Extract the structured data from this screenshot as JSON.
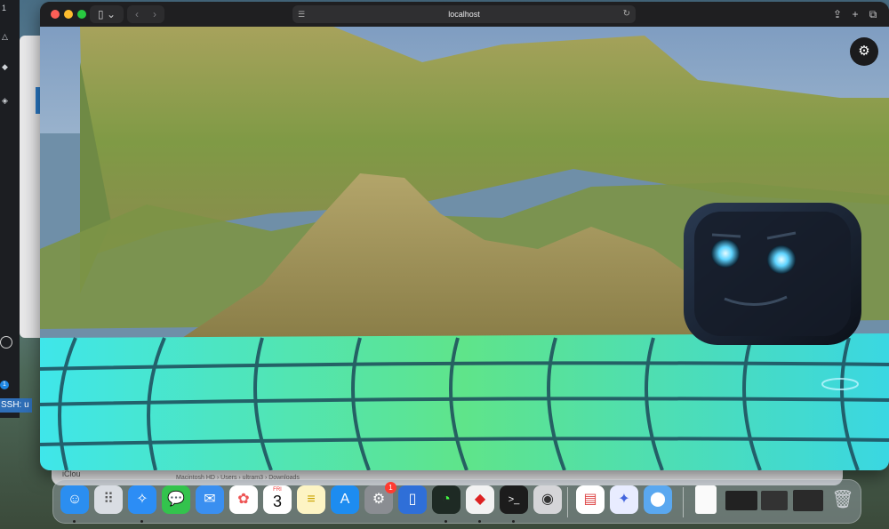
{
  "browser": {
    "address": "localhost",
    "icons": {
      "sidebar": "sidebar-icon",
      "back": "chevron-left-icon",
      "forward": "chevron-right-icon",
      "share": "share-icon",
      "new_tab": "plus-icon",
      "tabs": "tabs-overview-icon",
      "reload": "reload-icon"
    }
  },
  "scene": {
    "settings_icon": "gear-icon"
  },
  "background": {
    "ssh_badge": "SSH: u",
    "left_badge_count": "1",
    "finder": {
      "icloud_label": "iClou",
      "breadcrumb": "Macintosh HD › Users › ultram3 › Downloads"
    }
  },
  "dock": {
    "calendar_month": "FRI",
    "calendar_day": "3",
    "settings_badge": "1",
    "items": [
      {
        "name": "finder-icon"
      },
      {
        "name": "launchpad-icon"
      },
      {
        "name": "safari-icon"
      },
      {
        "name": "messages-icon"
      },
      {
        "name": "mail-icon"
      },
      {
        "name": "photos-icon"
      },
      {
        "name": "calendar-icon"
      },
      {
        "name": "notes-icon"
      },
      {
        "name": "app-store-icon"
      },
      {
        "name": "system-settings-icon"
      },
      {
        "name": "simulator-icon"
      },
      {
        "name": "activity-monitor-icon"
      },
      {
        "name": "apple-configurator-icon"
      },
      {
        "name": "terminal-icon"
      },
      {
        "name": "camera-icon"
      },
      {
        "name": "sheet-icon"
      },
      {
        "name": "chat-icon"
      },
      {
        "name": "app-icon"
      },
      {
        "name": "document-icon"
      },
      {
        "name": "trash-icon"
      }
    ]
  },
  "colors": {
    "close": "#fe5f57",
    "minimize": "#febc2e",
    "zoom": "#28c840",
    "floor_cyan": "#38e0e6",
    "floor_green": "#6fe07a",
    "terrain": "#9c9a55",
    "robot_body": "#1a2230",
    "robot_eyes": "#5fd4ff"
  }
}
